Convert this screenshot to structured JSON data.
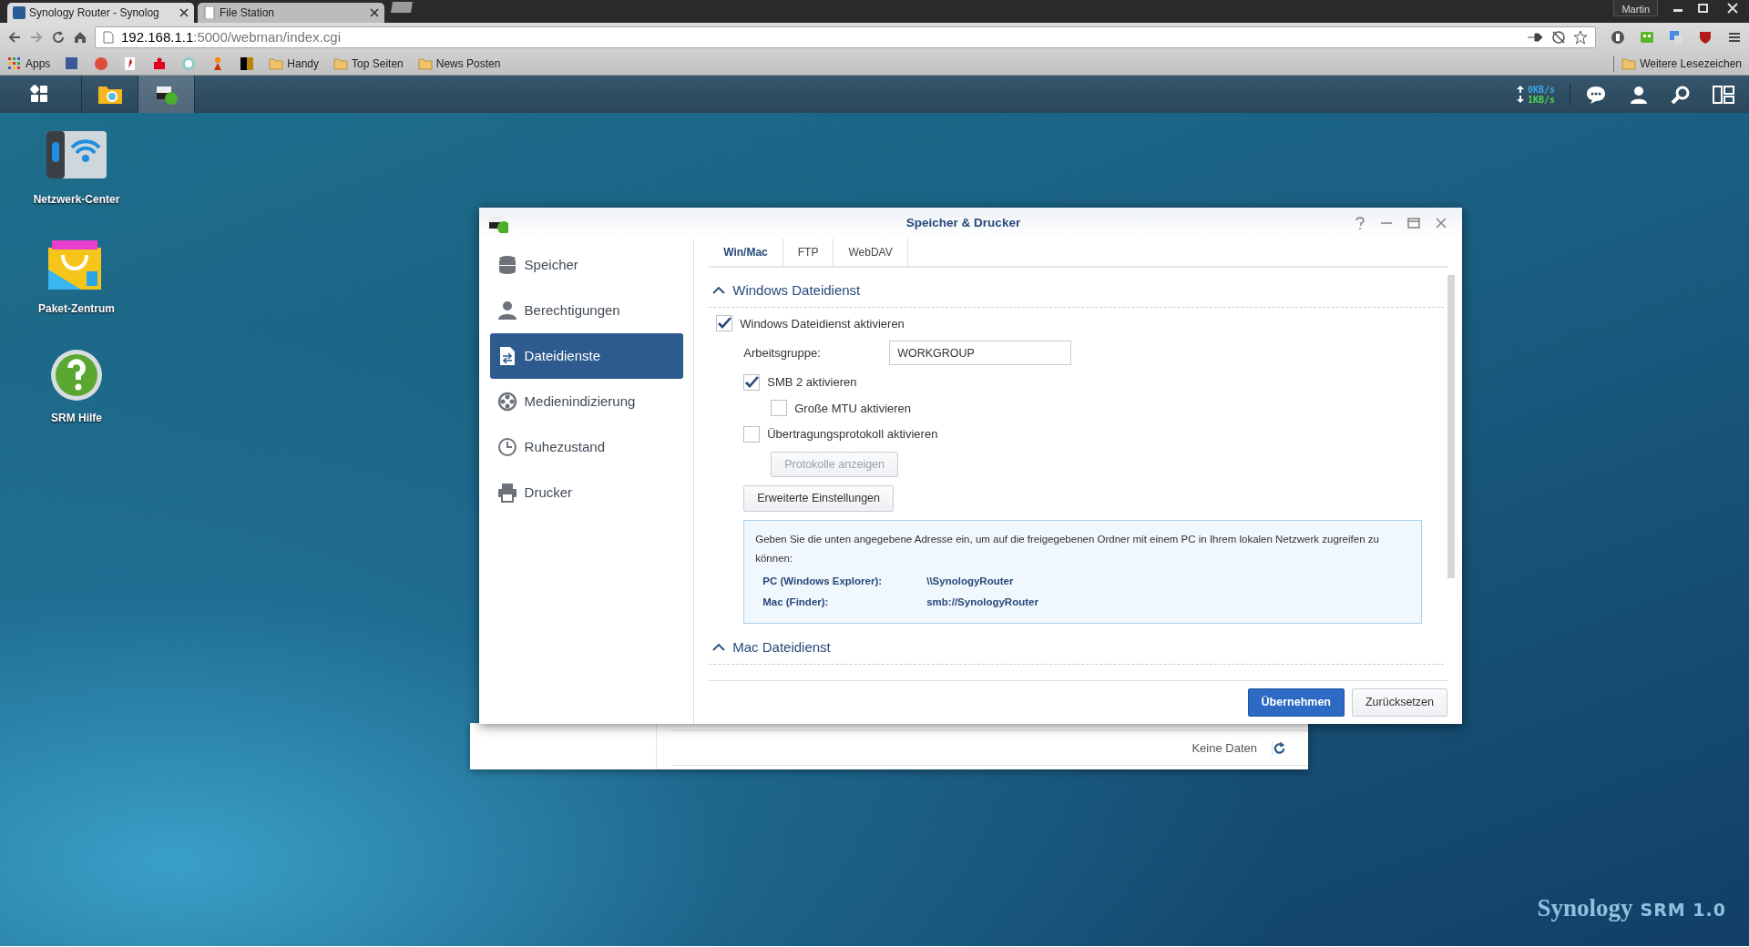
{
  "browser": {
    "tabs": [
      {
        "title": "Synology Router - Synolog",
        "kind": "srm",
        "selected": true
      },
      {
        "title": "File Station",
        "kind": "file",
        "selected": false
      }
    ],
    "user": "Martin",
    "url_host": "192.168.1.1",
    "url_path": ":5000/webman/index.cgi",
    "bookmarks": [
      {
        "label": "Apps",
        "kind": "apps"
      },
      {
        "kind": "blue"
      },
      {
        "kind": "red-round"
      },
      {
        "kind": "white-red"
      },
      {
        "kind": "red"
      },
      {
        "kind": "teal-round"
      },
      {
        "kind": "figure"
      },
      {
        "kind": "black-gold"
      },
      {
        "label": "Handy",
        "kind": "folder"
      },
      {
        "label": "Top Seiten",
        "kind": "folder"
      },
      {
        "label": "News Posten",
        "kind": "folder"
      }
    ],
    "other_bookmarks": "Weitere Lesezeichen"
  },
  "taskbar": {
    "apps": [
      {
        "kind": "main-menu",
        "selected": false
      },
      {
        "kind": "file-station",
        "selected": false
      },
      {
        "kind": "storage",
        "selected": true
      }
    ],
    "upload": "0KB/s",
    "download": "1KB/s"
  },
  "desktop_icons": [
    {
      "label": "Netzwerk-Center",
      "kind": "network"
    },
    {
      "label": "Paket-Zentrum",
      "kind": "package"
    },
    {
      "label": "SRM Hilfe",
      "kind": "help"
    }
  ],
  "background_window": {
    "status": "Keine Daten"
  },
  "dialog": {
    "title": "Speicher & Drucker",
    "sidebar": [
      {
        "label": "Speicher",
        "kind": "database",
        "selected": false
      },
      {
        "label": "Berechtigungen",
        "kind": "user",
        "selected": false
      },
      {
        "label": "Dateidienste",
        "kind": "file-transfer",
        "selected": true
      },
      {
        "label": "Medienindizierung",
        "kind": "film",
        "selected": false
      },
      {
        "label": "Ruhezustand",
        "kind": "clock",
        "selected": false
      },
      {
        "label": "Drucker",
        "kind": "printer",
        "selected": false
      }
    ],
    "tabs": [
      {
        "label": "Win/Mac",
        "selected": true
      },
      {
        "label": "FTP",
        "selected": false
      },
      {
        "label": "WebDAV",
        "selected": false
      }
    ],
    "sections": [
      {
        "title": "Windows Dateidienst",
        "expanded": true,
        "items": [
          {
            "kind": "checkbox",
            "label": "Windows Dateidienst aktivieren",
            "checked": true,
            "children": [
              {
                "kind": "field",
                "label": "Arbeitsgruppe:",
                "value": "WORKGROUP"
              },
              {
                "kind": "checkbox",
                "label": "SMB 2 aktivieren",
                "checked": true,
                "children": [
                  {
                    "kind": "checkbox",
                    "label": "Große MTU aktivieren",
                    "checked": false
                  }
                ]
              },
              {
                "kind": "checkbox",
                "label": "Übertragungsprotokoll aktivieren",
                "checked": false,
                "children": [
                  {
                    "kind": "button",
                    "label": "Protokolle anzeigen",
                    "disabled": true
                  }
                ]
              },
              {
                "kind": "button",
                "label": "Erweiterte Einstellungen",
                "disabled": false
              },
              {
                "kind": "info",
                "text": "Geben Sie die unten angegebene Adresse ein, um auf die freigegebenen Ordner mit einem PC in Ihrem lokalen Netzwerk zugreifen zu können:",
                "entries": [
                  {
                    "label": "PC (Windows Explorer):",
                    "value": "\\\\SynologyRouter"
                  },
                  {
                    "label": "Mac (Finder):",
                    "value": "smb://SynologyRouter"
                  }
                ]
              }
            ]
          }
        ]
      },
      {
        "title": "Mac Dateidienst",
        "expanded": true
      }
    ],
    "buttons": [
      {
        "label": "Übernehmen",
        "kind": "primary"
      },
      {
        "label": "Zurücksetzen",
        "kind": "secondary"
      }
    ]
  },
  "branding": {
    "name": "Synology",
    "product": "SRM 1.0"
  }
}
